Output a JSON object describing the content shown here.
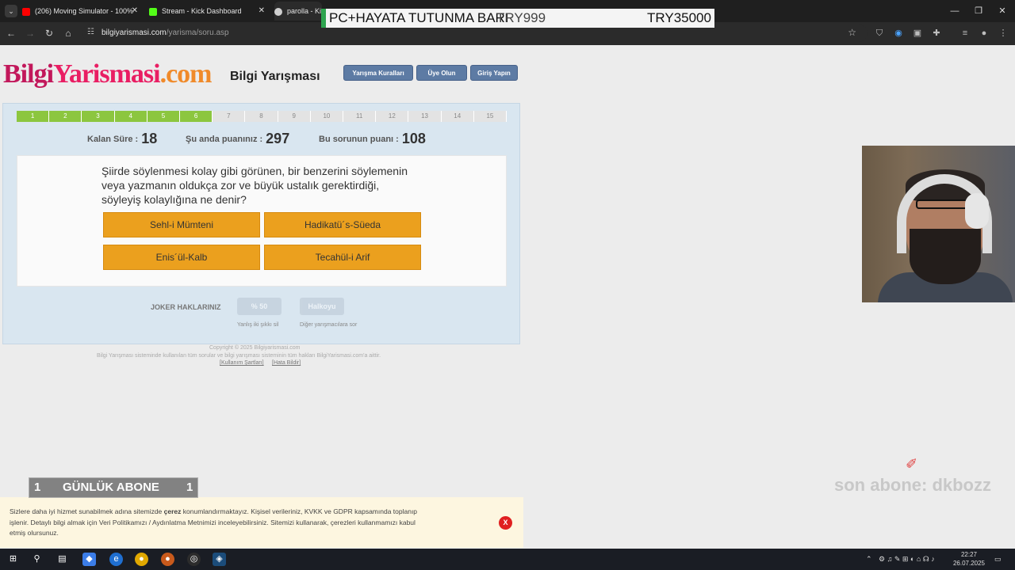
{
  "browser": {
    "tablist_icon": "chevron-down",
    "tabs": [
      {
        "title": "(206) Moving Simulator - 100%",
        "icon": "youtube-icon",
        "color": "#ff0000"
      },
      {
        "title": "Stream - Kick Dashboard",
        "icon": "kick-icon",
        "color": "#53fc18"
      },
      {
        "title": "parolla - Ki",
        "icon": "globe-icon",
        "color": "#cfcfcf"
      }
    ],
    "url_host": "bilgiyarismasi.com",
    "url_path": "/yarisma/soru.asp"
  },
  "stream_overlay": {
    "goal_text": "PC+HAYATA TUTUNMA BARI",
    "current": "TRY999",
    "target": "TRY35000"
  },
  "site": {
    "logo": {
      "part1": "Bilgi",
      "part2": "Yarismasi",
      "part3": ".com"
    },
    "title": "Bilgi Yarışması",
    "buttons": {
      "rules": "Yarışma Kuralları",
      "signup": "Üye Olun",
      "login": "Giriş Yapın"
    }
  },
  "quiz": {
    "steps": [
      "1",
      "2",
      "3",
      "4",
      "5",
      "6",
      "7",
      "8",
      "9",
      "10",
      "11",
      "12",
      "13",
      "14",
      "15"
    ],
    "completed_steps": 6,
    "time_left_label": "Kalan Süre :",
    "time_left": "18",
    "score_label": "Şu anda puanınız :",
    "score": "297",
    "question_points_label": "Bu sorunun puanı :",
    "question_points": "108",
    "question": "Şiirde söylenmesi kolay gibi görünen, bir benzerini söylemenin veya yazmanın oldukça zor ve büyük ustalık gerektirdiği, söyleyiş kolaylığına ne denir?",
    "answers": [
      "Sehl-i Mümteni",
      "Hadikatü´s-Süeda",
      "Enis´ül-Kalb",
      "Tecahül-i Arif"
    ],
    "jokers": {
      "label": "JOKER HAKLARINIZ",
      "fifty": "% 50",
      "fifty_hint": "Yanlış iki şıkkı sil",
      "audience": "Halkoyu",
      "audience_hint": "Diğer yarışmacılara sor"
    }
  },
  "footer": {
    "copyright": "Copyright © 2025 Bilgiyarismasi.com",
    "rights": "Bilgi Yarışması sisteminde kullanılan tüm sorular ve bilgi yarışması sisteminin tüm hakları BilgiYarismasi.com'a aittir.",
    "terms_link": "[Kullanım Şartları]",
    "report_link": "[Hata Bildir]"
  },
  "cookie": {
    "line1_a": "Sizlere daha iyi hizmet sunabilmek adına sitemizde ",
    "line1_b": "çerez",
    "line1_c": " konumlandırmaktayız. Kişisel verileriniz, KVKK ve GDPR kapsamında toplanıp",
    "line2_a": "işlenir. Detaylı bilgi almak için Veri Politikamızı / Aydınlatma Metnimizi",
    "line2_b": " inceleyebilirsiniz. Sitemizi kullanarak, çerezleri kullanmamızı kabul",
    "line3": "etmiş olursunuz.",
    "close": "X"
  },
  "stream_widgets": {
    "sub_counter_left": "1",
    "sub_counter_label": "GÜNLÜK ABONE",
    "sub_counter_right": "1",
    "last_sub": "son abone: dkbozz"
  },
  "taskbar": {
    "time": "22:27",
    "date": "26.07.2025"
  }
}
